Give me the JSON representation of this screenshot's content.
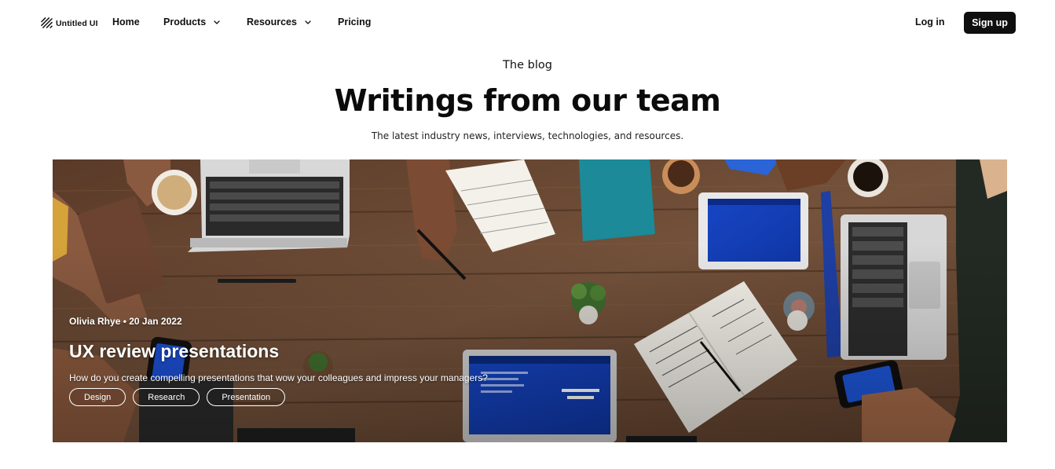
{
  "brand": {
    "name": "Untitled UI",
    "logo_icon": "stripes-logo-icon"
  },
  "nav": {
    "items": [
      {
        "label": "Home",
        "has_dropdown": false
      },
      {
        "label": "Products",
        "has_dropdown": true
      },
      {
        "label": "Resources",
        "has_dropdown": true
      },
      {
        "label": "Pricing",
        "has_dropdown": false
      }
    ],
    "login_label": "Log in",
    "signup_label": "Sign up"
  },
  "hero": {
    "eyebrow": "The blog",
    "title": "Writings from our team",
    "subtitle": "The latest industry news, interviews, technologies, and resources."
  },
  "featured_post": {
    "meta": "Olivia Rhye • 20 Jan 2022",
    "title": "UX review presentations",
    "description": "How do you create compelling presentations that wow your colleagues and impress your managers?",
    "tags": [
      "Design",
      "Research",
      "Presentation"
    ],
    "image_alt": "Overhead view of a team working at a wooden table with laptops, tablets, notebooks and coffee"
  },
  "colors": {
    "accent": "#0f0f0f",
    "text": "#101010",
    "table_wood": "#6b4a36",
    "screen_blue": "#1a4fd0"
  }
}
